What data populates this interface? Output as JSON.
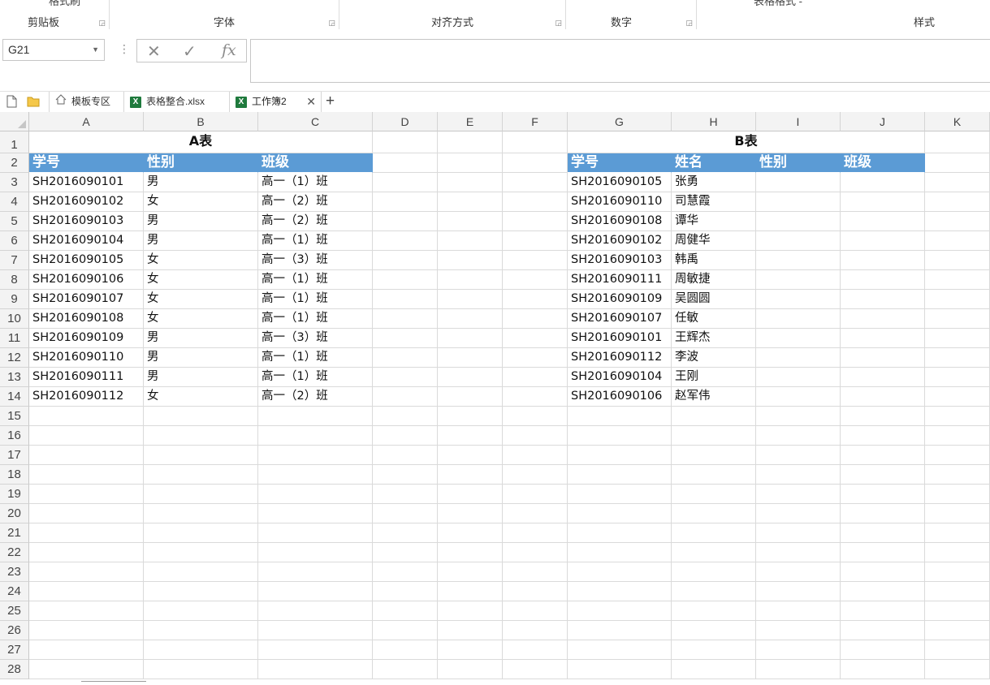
{
  "ribbon": {
    "groups": [
      {
        "label": "剪贴板",
        "launcher": true
      },
      {
        "label": "字体",
        "launcher": true
      },
      {
        "label": "对齐方式",
        "launcher": true
      },
      {
        "label": "数字",
        "launcher": true
      },
      {
        "label": "样式",
        "launcher": false
      }
    ],
    "clipped_top": [
      "格式刷",
      "表格格式 -"
    ]
  },
  "formula_bar": {
    "name_box": "G21",
    "cancel_glyph": "✕",
    "enter_glyph": "✓",
    "fx_glyph": "fx",
    "formula": ""
  },
  "tabs": [
    {
      "label": "模板专区",
      "icon": "home-icon"
    },
    {
      "label": "表格整合.xlsx",
      "icon": "excel-file-icon"
    },
    {
      "label": "工作簿2",
      "icon": "excel-file-icon",
      "active": true,
      "close": "✕"
    }
  ],
  "new_tab_glyph": "+",
  "columns": [
    "A",
    "B",
    "C",
    "D",
    "E",
    "F",
    "G",
    "H",
    "I",
    "J",
    "K"
  ],
  "rows": [
    "1",
    "2",
    "3",
    "4",
    "5",
    "6",
    "7",
    "8",
    "9",
    "10",
    "11",
    "12",
    "13",
    "14",
    "15",
    "16",
    "17",
    "18",
    "19",
    "20",
    "21",
    "22",
    "23",
    "24",
    "25",
    "26",
    "27",
    "28"
  ],
  "table_a": {
    "title": "A表",
    "headers": [
      "学号",
      "性别",
      "班级"
    ],
    "data": [
      [
        "SH2016090101",
        "男",
        "高一（1）班"
      ],
      [
        "SH2016090102",
        "女",
        "高一（2）班"
      ],
      [
        "SH2016090103",
        "男",
        "高一（2）班"
      ],
      [
        "SH2016090104",
        "男",
        "高一（1）班"
      ],
      [
        "SH2016090105",
        "女",
        "高一（3）班"
      ],
      [
        "SH2016090106",
        "女",
        "高一（1）班"
      ],
      [
        "SH2016090107",
        "女",
        "高一（1）班"
      ],
      [
        "SH2016090108",
        "女",
        "高一（1）班"
      ],
      [
        "SH2016090109",
        "男",
        "高一（3）班"
      ],
      [
        "SH2016090110",
        "男",
        "高一（1）班"
      ],
      [
        "SH2016090111",
        "男",
        "高一（1）班"
      ],
      [
        "SH2016090112",
        "女",
        "高一（2）班"
      ]
    ]
  },
  "table_b": {
    "title": "B表",
    "headers": [
      "学号",
      "姓名",
      "性别",
      "班级"
    ],
    "data": [
      [
        "SH2016090105",
        "张勇",
        "",
        ""
      ],
      [
        "SH2016090110",
        "司慧霞",
        "",
        ""
      ],
      [
        "SH2016090108",
        "谭华",
        "",
        ""
      ],
      [
        "SH2016090102",
        "周健华",
        "",
        ""
      ],
      [
        "SH2016090103",
        "韩禹",
        "",
        ""
      ],
      [
        "SH2016090111",
        "周敏捷",
        "",
        ""
      ],
      [
        "SH2016090109",
        "吴圆圆",
        "",
        ""
      ],
      [
        "SH2016090107",
        "任敏",
        "",
        ""
      ],
      [
        "SH2016090101",
        "王辉杰",
        "",
        ""
      ],
      [
        "SH2016090112",
        "李波",
        "",
        ""
      ],
      [
        "SH2016090104",
        "王刚",
        "",
        ""
      ],
      [
        "SH2016090106",
        "赵军伟",
        "",
        ""
      ]
    ]
  },
  "colors": {
    "header_fill": "#5b9bd5",
    "header_text": "#ffffff",
    "gridline": "#dadada",
    "excel_icon": "#1f7a3d"
  }
}
